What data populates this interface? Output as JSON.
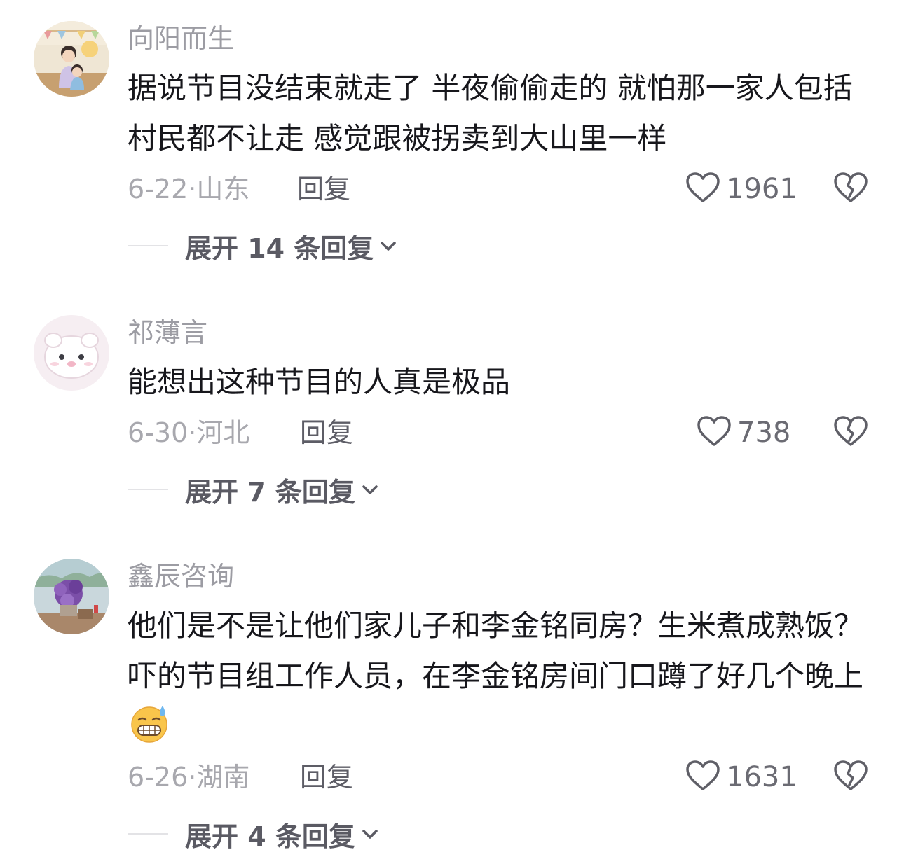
{
  "comments": [
    {
      "username": "向阳而生",
      "text": "据说节目没结束就走了 半夜偷偷走的  就怕那一家人包括村民都不让走 感觉跟被拐卖到大山里一样",
      "date": "6-22",
      "separator": "·",
      "location": "山东",
      "reply_label": "回复",
      "likes": "1961",
      "expand_label": "展开 14 条回复"
    },
    {
      "username": "祁薄言",
      "text": "能想出这种节目的人真是极品",
      "date": "6-30",
      "separator": "·",
      "location": "河北",
      "reply_label": "回复",
      "likes": "738",
      "expand_label": "展开 7 条回复"
    },
    {
      "username": "鑫辰咨询",
      "text": "他们是不是让他们家儿子和李金铭同房？生米煮成熟饭？吓的节目组工作人员，在李金铭房间门口蹲了好几个晚上",
      "emoji": "grimacing-sweat-emoji",
      "date": "6-26",
      "separator": "·",
      "location": "湖南",
      "reply_label": "回复",
      "likes": "1631",
      "expand_label": "展开 4 条回复"
    }
  ],
  "icons": {
    "like": "heart-outline-icon",
    "dislike": "broken-heart-icon",
    "expand": "chevron-down-icon"
  },
  "colors": {
    "username": "#9c9ca3",
    "text": "#17171c",
    "meta": "#a8a8ae",
    "reply": "#5d5d66",
    "expand": "#5a5a63"
  }
}
